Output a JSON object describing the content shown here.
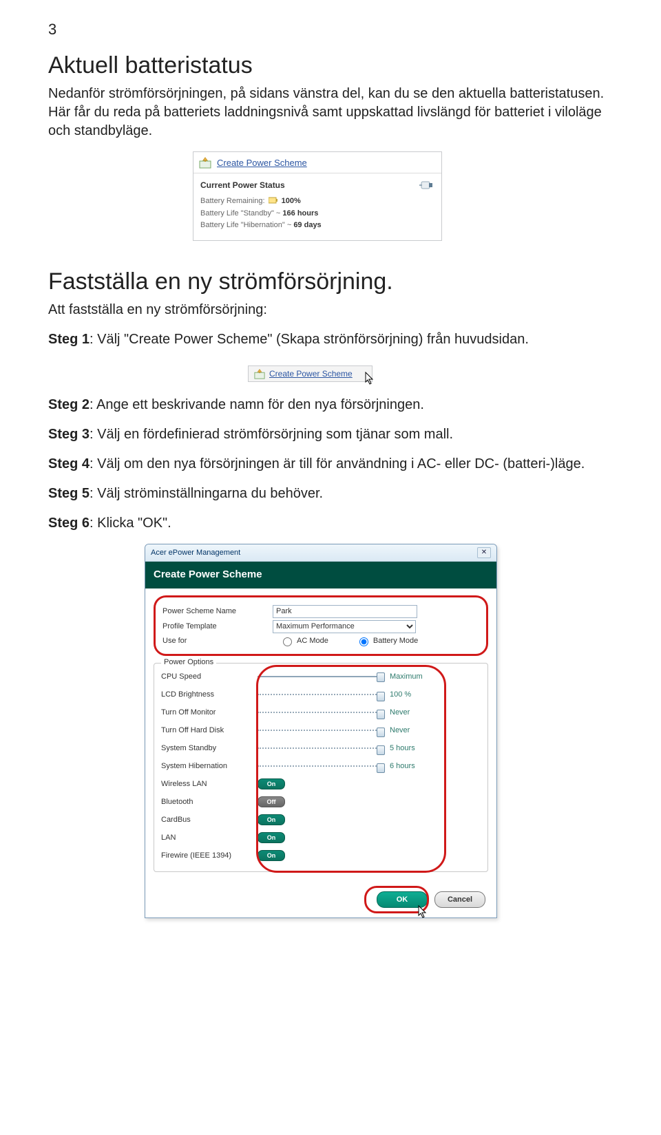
{
  "page_number": "3",
  "h_aktuell": "Aktuell batteristatus",
  "p_aktuell": "Nedanför strömförsörjningen, på sidans vänstra del, kan du se den aktuella batteristatusen. Här får du reda på batteriets laddningsnivå samt uppskattad livslängd för batteriet i viloläge och standbyläge.",
  "widget": {
    "header_link": "Create Power Scheme",
    "status_title": "Current Power Status",
    "line1_label": "Battery Remaining:",
    "line1_value": "100%",
    "line2_label": "Battery Life \"Standby\" ~",
    "line2_value": "166 hours",
    "line3_label": "Battery Life \"Hibernation\" ~",
    "line3_value": "69 days"
  },
  "h_fast": "Fastställa en ny strömförsörjning.",
  "p_fast_intro": "Att fastställa en ny strömförsörjning:",
  "step1_b": "Steg 1",
  "step1_rest": ": Välj \"Create Power Scheme\" (Skapa strönförsörjning) från huvudsidan.",
  "link_widget_label": "Create Power Scheme",
  "step2_b": "Steg 2",
  "step2_rest": ": Ange ett beskrivande namn för den nya försörjningen.",
  "step3_b": "Steg 3",
  "step3_rest": ": Välj en fördefinierad strömförsörjning som tjänar som mall.",
  "step4_b": "Steg 4",
  "step4_rest": ": Välj om den nya försörjningen är till för användning i AC- eller DC- (batteri-)läge.",
  "step5_b": "Steg 5",
  "step5_rest": ": Välj ströminställningarna du behöver.",
  "step6_b": "Steg 6",
  "step6_rest": ": Klicka \"OK\".",
  "dialog": {
    "titlebar": "Acer ePower Management",
    "header": "Create Power Scheme",
    "label_name": "Power Scheme Name",
    "name_value": "Park",
    "label_template": "Profile Template",
    "template_value": "Maximum Performance",
    "label_usefor": "Use for",
    "radio_ac": "AC Mode",
    "radio_dc": "Battery Mode",
    "fieldset_title": "Power Options",
    "options": [
      {
        "label": "CPU Speed",
        "value": "Maximum",
        "type": "slider",
        "dotted": false
      },
      {
        "label": "LCD Brightness",
        "value": "100 %",
        "type": "slider",
        "dotted": true
      },
      {
        "label": "Turn Off Monitor",
        "value": "Never",
        "type": "slider",
        "dotted": true
      },
      {
        "label": "Turn Off Hard Disk",
        "value": "Never",
        "type": "slider",
        "dotted": true
      },
      {
        "label": "System Standby",
        "value": "5 hours",
        "type": "slider",
        "dotted": true
      },
      {
        "label": "System Hibernation",
        "value": "6 hours",
        "type": "slider",
        "dotted": true
      },
      {
        "label": "Wireless LAN",
        "value": "On",
        "type": "toggle"
      },
      {
        "label": "Bluetooth",
        "value": "Off",
        "type": "toggle"
      },
      {
        "label": "CardBus",
        "value": "On",
        "type": "toggle"
      },
      {
        "label": "LAN",
        "value": "On",
        "type": "toggle"
      },
      {
        "label": "Firewire (IEEE 1394)",
        "value": "On",
        "type": "toggle"
      }
    ],
    "btn_ok": "OK",
    "btn_cancel": "Cancel"
  }
}
